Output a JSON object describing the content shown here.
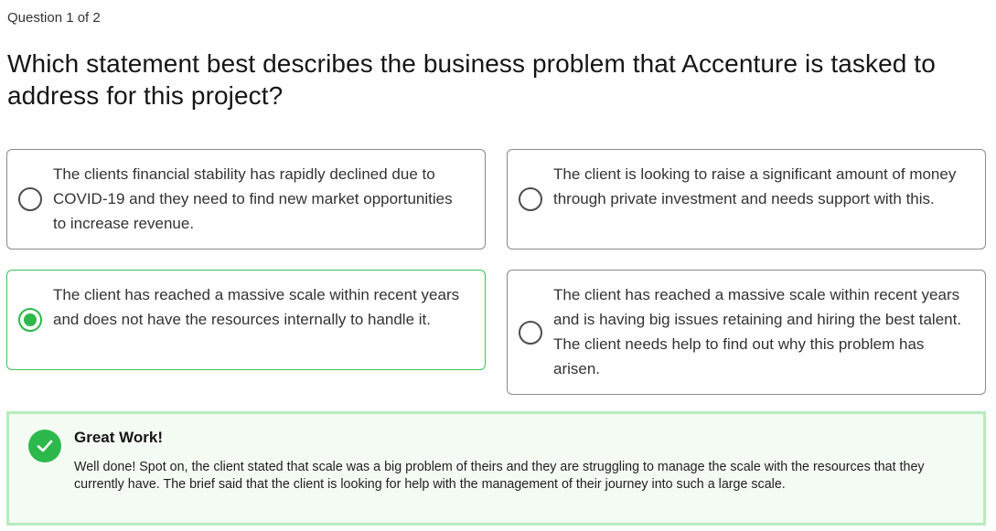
{
  "header": {
    "counter": "Question 1 of 2",
    "question": "Which statement best describes the business problem that Accenture is tasked to address for this project?"
  },
  "options": [
    {
      "text": "The clients financial stability has rapidly declined due to COVID-19 and they need to find new market opportunities to increase revenue.",
      "selected": false
    },
    {
      "text": "The client is looking to raise a significant amount of money through private investment and needs support with this.",
      "selected": false
    },
    {
      "text": "The client has reached a massive scale within recent years and does not have the resources internally to handle it.",
      "selected": true
    },
    {
      "text": "The client has reached a massive scale within recent years and is having big issues retaining and hiring the best talent. The client needs help to find out why this problem has arisen.",
      "selected": false
    }
  ],
  "feedback": {
    "icon": "check-circle-icon",
    "title": "Great Work!",
    "body": "Well done! Spot on, the client stated that scale was a big problem of theirs and they are struggling to manage the scale with the resources that they currently have. The brief said that the client is looking for help with the management of their journey into such a large scale."
  },
  "colors": {
    "accent_green": "#2db84b",
    "selected_border": "#3ec25a",
    "feedback_border": "#b6ecbf",
    "feedback_bg": "#f3fbf2"
  }
}
